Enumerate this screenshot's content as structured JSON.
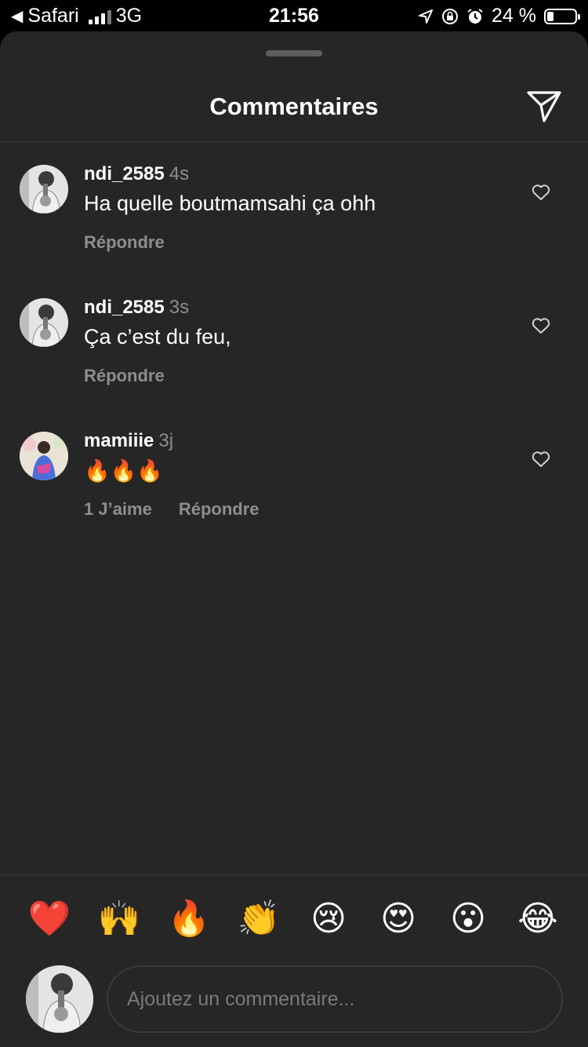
{
  "status_bar": {
    "back_app": "Safari",
    "network": "3G",
    "time": "21:56",
    "battery_percent": "24 %",
    "battery_level": 0.24
  },
  "header": {
    "title": "Commentaires",
    "send_icon": "paper-plane-icon"
  },
  "comments": [
    {
      "user": "ndi_2585",
      "time": "4s",
      "text": "Ha quelle boutmamsahi ça ohh",
      "likes": "",
      "reply": "Répondre"
    },
    {
      "user": "ndi_2585",
      "time": "3s",
      "text": "Ça c’est du feu,",
      "likes": "",
      "reply": "Répondre"
    },
    {
      "user": "mamiiie",
      "time": "3j",
      "text": "🔥🔥🔥",
      "likes": "1 J’aime",
      "reply": "Répondre"
    }
  ],
  "emoji_bar": [
    "❤️",
    "🙌",
    "🔥",
    "👏",
    "😢",
    "😍",
    "😮",
    "😂"
  ],
  "composer": {
    "placeholder": "Ajoutez un commentaire..."
  },
  "colors": {
    "sheet_bg": "#262626",
    "text_primary": "#ffffff",
    "text_secondary": "#8e8e8e",
    "divider": "#3a3a3a"
  }
}
